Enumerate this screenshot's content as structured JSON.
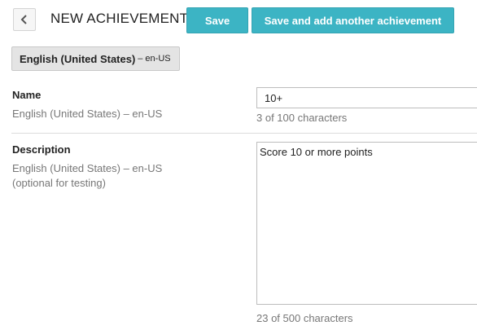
{
  "header": {
    "back_icon": "chevron-left-icon",
    "title": "NEW ACHIEVEMENT",
    "save_label": "Save",
    "save_add_label": "Save and add another achievement",
    "accent_color": "#3cb4c4"
  },
  "language_tab": {
    "name": "English (United States)",
    "separator": "–",
    "code": "en-US"
  },
  "name_field": {
    "label": "Name",
    "language": "English (United States) – en-US",
    "value": "10+",
    "counter": "3 of 100 characters"
  },
  "description_field": {
    "label": "Description",
    "language": "English (United States) – en-US",
    "note": "(optional for testing)",
    "value": "Score 10 or more points",
    "counter": "23 of 500 characters"
  }
}
